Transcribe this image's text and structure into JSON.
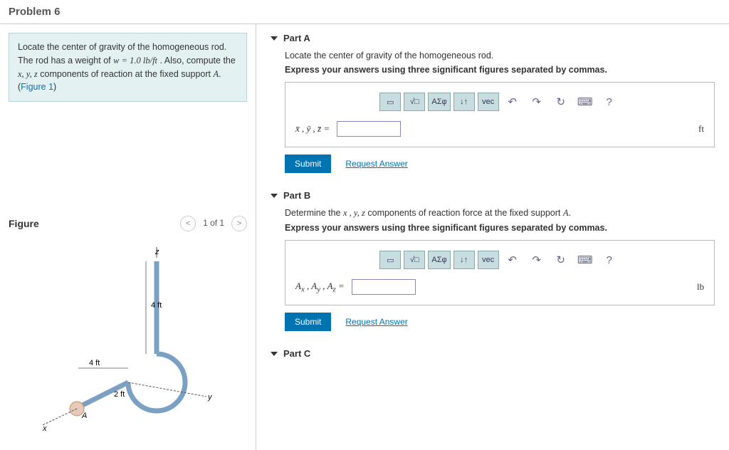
{
  "header": {
    "title": "Problem 6"
  },
  "problem": {
    "intro1": "Locate the center of gravity of the homogeneous rod. The rod has a weight of ",
    "weight_expr": "w = 1.0 lb/ft",
    "intro2": " . Also, compute the ",
    "vars": "x, y, z",
    "intro3": " components of reaction at the fixed support ",
    "support": "A",
    "intro4": ". (",
    "fig_link": "Figure 1",
    "intro5": ")"
  },
  "figure": {
    "title": "Figure",
    "nav_label": "1 of 1",
    "labels": {
      "z": "z",
      "y": "y",
      "x": "x",
      "A": "A",
      "d1": "4 ft",
      "d2": "4 ft",
      "d3": "2 ft"
    }
  },
  "toolbar": {
    "templates": "▭",
    "sqrt": "√□",
    "greek": "ΑΣφ",
    "updown": "↓↑",
    "vec": "vec",
    "undo": "↶",
    "redo": "↷",
    "reset": "↻",
    "keyboard": "⌨",
    "help": "?"
  },
  "partA": {
    "title": "Part A",
    "prompt": "Locate the center of gravity of the homogeneous rod.",
    "instruction": "Express your answers using three significant figures separated by commas.",
    "label": "x̄ , ȳ , z̄  =",
    "unit": "ft",
    "submit": "Submit",
    "request": "Request Answer"
  },
  "partB": {
    "title": "Part B",
    "prompt_pre": "Determine the ",
    "prompt_vars": "x , y, z",
    "prompt_mid": " components of reaction force at the fixed support ",
    "prompt_support": "A",
    "prompt_post": ".",
    "instruction": "Express your answers using three significant figures separated by commas.",
    "label": "Aₓ , A_y , A_z  =",
    "unit": "lb",
    "submit": "Submit",
    "request": "Request Answer"
  },
  "partC": {
    "title": "Part C"
  }
}
